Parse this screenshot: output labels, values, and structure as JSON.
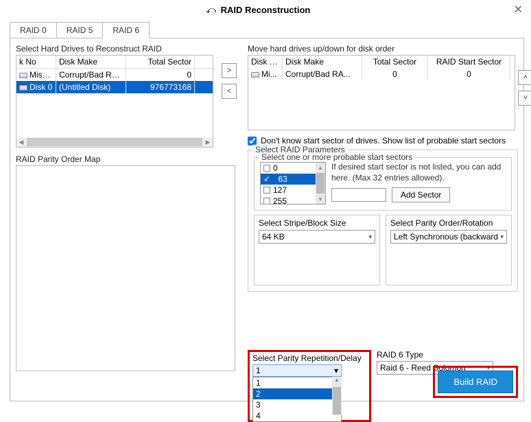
{
  "window": {
    "title": "RAID Reconstruction"
  },
  "tabs": {
    "t0": "RAID 0",
    "t1": "RAID 5",
    "t2": "RAID 6"
  },
  "left": {
    "select_label": "Select Hard Drives to Reconstruct RAID",
    "hdr": {
      "c1": "k No",
      "c2": "Disk Make",
      "c3": "Total Sector"
    },
    "rows": [
      {
        "no": "Missing...",
        "make": "Corrupt/Bad RA...",
        "sector": "0"
      },
      {
        "no": "Disk 0",
        "make": "(Untitled Disk)",
        "sector": "976773168"
      }
    ],
    "parity_label": "RAID Parity Order Map"
  },
  "right": {
    "order_label": "Move hard drives up/down for disk order",
    "hdr": {
      "c1": "Disk No",
      "c2": "Disk Make",
      "c3": "Total Sector",
      "c4": "RAID Start Sector"
    },
    "rows": [
      {
        "no": "Mi...",
        "make": "Corrupt/Bad RA...",
        "sector": "0",
        "start": "0"
      }
    ],
    "dontknow": "Don't know start sector of drives. Show list of probable start sectors",
    "params_legend": "Select RAID Parameters",
    "sectors_legend": "Select one or more probable start sectors",
    "sectors": {
      "s0": "0",
      "s1": "63",
      "s2": "127",
      "s3": "255"
    },
    "hint": "If desired start sector is not listed, you can add here. (Max 32 entries allowed).",
    "add_sector": "Add Sector",
    "stripe": {
      "label": "Select Stripe/Block Size",
      "value": "64 KB"
    },
    "rotation": {
      "label": "Select Parity Order/Rotation",
      "value": "Left Synchronous (backward"
    },
    "parityrep": {
      "label": "Select Parity Repetition/Delay",
      "value": "1",
      "opts": {
        "o1": "1",
        "o2": "2",
        "o3": "3",
        "o4": "4"
      }
    },
    "raid6type": {
      "label": "RAID 6 Type",
      "value": "Raid 6 - Reed Solomon"
    },
    "build": "Build RAID"
  }
}
